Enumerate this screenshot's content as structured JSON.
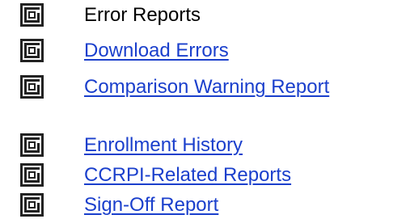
{
  "menu": {
    "items": [
      {
        "icon": "square-spiral-icon",
        "label": "Error Reports"
      },
      {
        "icon": "square-spiral-icon",
        "label": "Download Errors"
      },
      {
        "icon": "square-spiral-icon",
        "label": "Comparison Warning Report"
      },
      {
        "icon": "square-spiral-icon",
        "label": "Enrollment History"
      },
      {
        "icon": "square-spiral-icon",
        "label": "CCRPI-Related Reports"
      },
      {
        "icon": "square-spiral-icon",
        "label": "Sign-Off Report"
      }
    ]
  },
  "colors": {
    "link": "#1a3fcc",
    "text": "#000000",
    "icon": "#222222"
  }
}
